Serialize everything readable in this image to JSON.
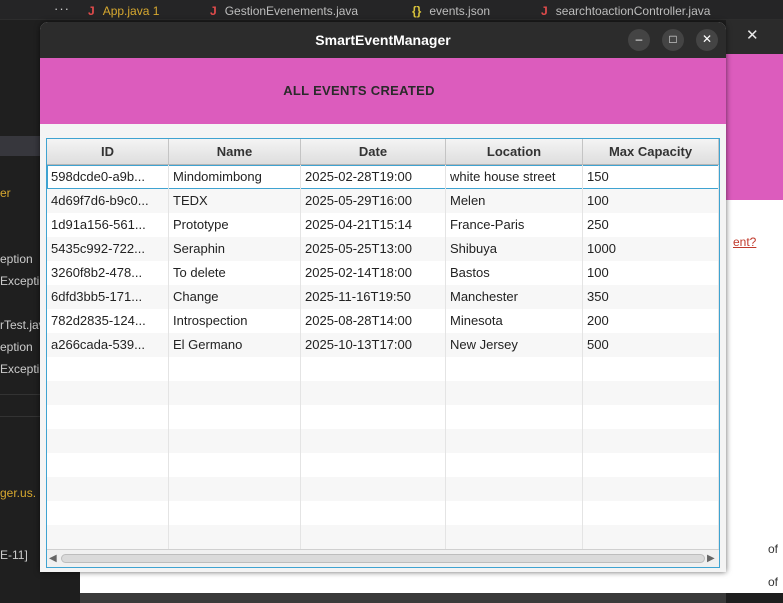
{
  "ide": {
    "tabs": [
      {
        "icon": "J",
        "label": "App.java 1",
        "color": "#d7a82f"
      },
      {
        "icon": "J",
        "label": "GestionEvenements.java",
        "color": "#bdbdbd"
      },
      {
        "icon": "{}",
        "label": "events.json",
        "color": "#bdbdbd"
      },
      {
        "icon": "J",
        "label": "searchtoactionController.java",
        "color": "#bdbdbd"
      }
    ],
    "more_dots": "···",
    "sidebar": [
      {
        "text": "er",
        "cls": "y"
      },
      {
        "text": "eption",
        "cls": ""
      },
      {
        "text": "Excepti",
        "cls": ""
      },
      {
        "text": "rTest.jav",
        "cls": ""
      },
      {
        "text": "eption",
        "cls": ""
      },
      {
        "text": "Excepti",
        "cls": ""
      },
      {
        "text": "ger.us.",
        "cls": "y"
      },
      {
        "text": "E-11]",
        "cls": ""
      }
    ],
    "back_dialog_close": "✕",
    "back_dialog_link": "ent?",
    "back_dialog_tail": "of"
  },
  "window": {
    "title": "SmartEventManager",
    "minimize": "–",
    "maximize": "□",
    "close": "✕",
    "header": "ALL EVENTS CREATED"
  },
  "table": {
    "columns": [
      "ID",
      "Name",
      "Date",
      "Location",
      "Max Capacity"
    ],
    "rows": [
      [
        "598dcde0-a9b...",
        "Mindomimbong",
        "2025-02-28T19:00",
        "white house street",
        "150"
      ],
      [
        "4d69f7d6-b9c0...",
        "TEDX",
        "2025-05-29T16:00",
        "Melen",
        "100"
      ],
      [
        "1d91a156-561...",
        "Prototype",
        "2025-04-21T15:14",
        "France-Paris",
        "250"
      ],
      [
        "5435c992-722...",
        "Seraphin",
        "2025-05-25T13:00",
        "Shibuya",
        "1000"
      ],
      [
        "3260f8b2-478...",
        "To delete",
        "2025-02-14T18:00",
        "Bastos",
        "100"
      ],
      [
        "6dfd3bb5-171...",
        "Change",
        "2025-11-16T19:50",
        "Manchester",
        "350"
      ],
      [
        "782d2835-124...",
        "Introspection",
        "2025-08-28T14:00",
        "Minesota",
        "200"
      ],
      [
        "a266cada-539...",
        "El Germano",
        "2025-10-13T17:00",
        "New Jersey",
        "500"
      ]
    ],
    "selected_row": 0,
    "empty_rows": 8
  },
  "colors": {
    "header_pink": "#dc5cbd",
    "selection_blue": "#3fa3d1"
  }
}
